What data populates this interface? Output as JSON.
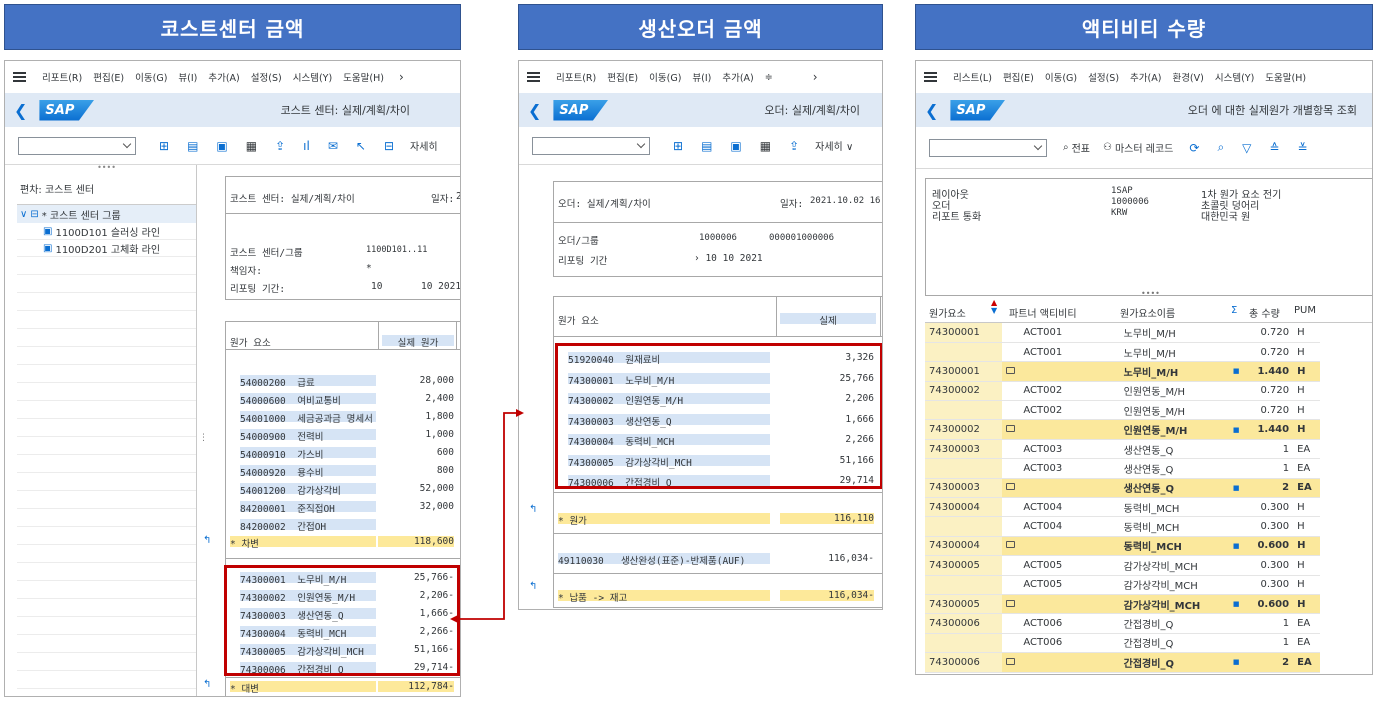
{
  "headers": {
    "h1": "코스트센터 금액",
    "h2": "생산오더 금액",
    "h3": "액티비티 수량"
  },
  "p1": {
    "menu": [
      "리포트(R)",
      "편집(E)",
      "이동(G)",
      "뷰(I)",
      "추가(A)",
      "설정(S)",
      "시스템(Y)",
      "도움말(H)"
    ],
    "logo": "SAP",
    "title": "코스트 센터: 실제/계획/차이",
    "toolbar_more": "자세히",
    "tree_title": "편차: 코스트 센터",
    "tree_root": "* 코스트 센터 그룹",
    "tree_items": [
      "1100D101 슬러싱 라인",
      "1100D201 고체화 라인"
    ],
    "report_title": "코스트 센터: 실제/계획/차이",
    "date_label": "일자:",
    "date_val": "2",
    "cc_label": "코스트 센터/그룹",
    "cc_val": "1100D101..11",
    "resp_label": "책임자:",
    "resp_val": "*",
    "period_label": "리포팅 기간:",
    "period_from": "10",
    "period_to": "10  2021",
    "col_elem": "원가 요소",
    "col_actual": "실제 원가",
    "rows1": [
      {
        "code": "54000200",
        "name": "급료",
        "val": "28,000"
      },
      {
        "code": "54000600",
        "name": "여비교통비",
        "val": "2,400"
      },
      {
        "code": "54001000",
        "name": "세금공과금 명세서",
        "val": "1,800"
      },
      {
        "code": "54000900",
        "name": "전력비",
        "val": "1,000"
      },
      {
        "code": "54000910",
        "name": "가스비",
        "val": "600"
      },
      {
        "code": "54000920",
        "name": "용수비",
        "val": "800"
      },
      {
        "code": "54001200",
        "name": "감가상각비",
        "val": "52,000"
      },
      {
        "code": "84200001",
        "name": "준직접OH",
        "val": "32,000"
      },
      {
        "code": "84200002",
        "name": "간접OH",
        "val": ""
      }
    ],
    "sum1_label": "*  차변",
    "sum1_val": "118,600",
    "rows2": [
      {
        "code": "74300001",
        "name": "노무비_M/H",
        "val": "25,766-"
      },
      {
        "code": "74300002",
        "name": "인원연동_M/H",
        "val": "2,206-"
      },
      {
        "code": "74300003",
        "name": "생산연동_Q",
        "val": "1,666-"
      },
      {
        "code": "74300004",
        "name": "동력비_MCH",
        "val": "2,266-"
      },
      {
        "code": "74300005",
        "name": "감가상각비_MCH",
        "val": "51,166-"
      },
      {
        "code": "74300006",
        "name": "간접경비_Q",
        "val": "29,714-"
      }
    ],
    "sum2_label": "*  대변",
    "sum2_val": "112,784-"
  },
  "p2": {
    "menu": [
      "리포트(R)",
      "편집(E)",
      "이동(G)",
      "뷰(I)",
      "추가(A)"
    ],
    "logo": "SAP",
    "title": "오더: 실제/계획/차이",
    "toolbar_more": "자세히",
    "report_title": "오더: 실제/계획/차이",
    "date_label": "일자:",
    "date_val": "2021.10.02 16",
    "grp_label": "오더/그룹",
    "grp_val1": "1000006",
    "grp_val2": "000001000006",
    "period_label": "리포팅 기간",
    "period_val": "10   10 2021",
    "col_elem": "원가 요소",
    "col_actual": "실제",
    "rows": [
      {
        "code": "51920040",
        "name": "원재료비",
        "val": "3,326"
      },
      {
        "code": "74300001",
        "name": "노무비_M/H",
        "val": "25,766"
      },
      {
        "code": "74300002",
        "name": "인원연동_M/H",
        "val": "2,206"
      },
      {
        "code": "74300003",
        "name": "생산연동_Q",
        "val": "1,666"
      },
      {
        "code": "74300004",
        "name": "동력비_MCH",
        "val": "2,266"
      },
      {
        "code": "74300005",
        "name": "감가상각비_MCH",
        "val": "51,166"
      },
      {
        "code": "74300006",
        "name": "간접경비_Q",
        "val": "29,714"
      }
    ],
    "sum_label": "*    원가",
    "sum_val": "116,110",
    "credit_code": "49110030",
    "credit_name": "생산완성(표준)-반제품(AUF)",
    "credit_val": "116,034-",
    "deliv_label": "*    납품 -> 재고",
    "deliv_val": "116,034-"
  },
  "p3": {
    "menu": [
      "리스트(L)",
      "편집(E)",
      "이동(G)",
      "설정(S)",
      "추가(A)",
      "환경(V)",
      "시스템(Y)",
      "도움말(H)"
    ],
    "logo": "SAP",
    "title": "오더 에 대한 실제원가 개별항목 조회",
    "tb_doc": "전표",
    "tb_master": "마스터 레코드",
    "info": [
      {
        "k": "레이아웃",
        "v1": "1SAP",
        "v2": "1차 원가 요소 전기"
      },
      {
        "k": "오더",
        "v1": "1000006",
        "v2": "초콜릿 덩어리"
      },
      {
        "k": "리포트 통화",
        "v1": "KRW",
        "v2": "대한민국 원"
      }
    ],
    "cols": [
      "원가요소",
      "파트너 액티비티",
      "원가요소이름",
      "Σ",
      "총 수량",
      "PUM"
    ],
    "rows": [
      {
        "ce": "74300001",
        "act": "ACT001",
        "name": "노무비_M/H",
        "qty": "0.720",
        "pum": "H",
        "t": 0
      },
      {
        "ce": "",
        "act": "ACT001",
        "name": "노무비_M/H",
        "qty": "0.720",
        "pum": "H",
        "t": 0
      },
      {
        "ce": "74300001",
        "act": "",
        "name": "노무비_M/H",
        "qty": "1.440",
        "pum": "H",
        "t": 1
      },
      {
        "ce": "74300002",
        "act": "ACT002",
        "name": "인원연동_M/H",
        "qty": "0.720",
        "pum": "H",
        "t": 0
      },
      {
        "ce": "",
        "act": "ACT002",
        "name": "인원연동_M/H",
        "qty": "0.720",
        "pum": "H",
        "t": 0
      },
      {
        "ce": "74300002",
        "act": "",
        "name": "인원연동_M/H",
        "qty": "1.440",
        "pum": "H",
        "t": 1
      },
      {
        "ce": "74300003",
        "act": "ACT003",
        "name": "생산연동_Q",
        "qty": "1",
        "pum": "EA",
        "t": 0
      },
      {
        "ce": "",
        "act": "ACT003",
        "name": "생산연동_Q",
        "qty": "1",
        "pum": "EA",
        "t": 0
      },
      {
        "ce": "74300003",
        "act": "",
        "name": "생산연동_Q",
        "qty": "2",
        "pum": "EA",
        "t": 1
      },
      {
        "ce": "74300004",
        "act": "ACT004",
        "name": "동력비_MCH",
        "qty": "0.300",
        "pum": "H",
        "t": 0
      },
      {
        "ce": "",
        "act": "ACT004",
        "name": "동력비_MCH",
        "qty": "0.300",
        "pum": "H",
        "t": 0
      },
      {
        "ce": "74300004",
        "act": "",
        "name": "동력비_MCH",
        "qty": "0.600",
        "pum": "H",
        "t": 1
      },
      {
        "ce": "74300005",
        "act": "ACT005",
        "name": "감가상각비_MCH",
        "qty": "0.300",
        "pum": "H",
        "t": 0
      },
      {
        "ce": "",
        "act": "ACT005",
        "name": "감가상각비_MCH",
        "qty": "0.300",
        "pum": "H",
        "t": 0
      },
      {
        "ce": "74300005",
        "act": "",
        "name": "감가상각비_MCH",
        "qty": "0.600",
        "pum": "H",
        "t": 1
      },
      {
        "ce": "74300006",
        "act": "ACT006",
        "name": "간접경비_Q",
        "qty": "1",
        "pum": "EA",
        "t": 0
      },
      {
        "ce": "",
        "act": "ACT006",
        "name": "간접경비_Q",
        "qty": "1",
        "pum": "EA",
        "t": 0
      },
      {
        "ce": "74300006",
        "act": "",
        "name": "간접경비_Q",
        "qty": "2",
        "pum": "EA",
        "t": 1
      }
    ]
  }
}
